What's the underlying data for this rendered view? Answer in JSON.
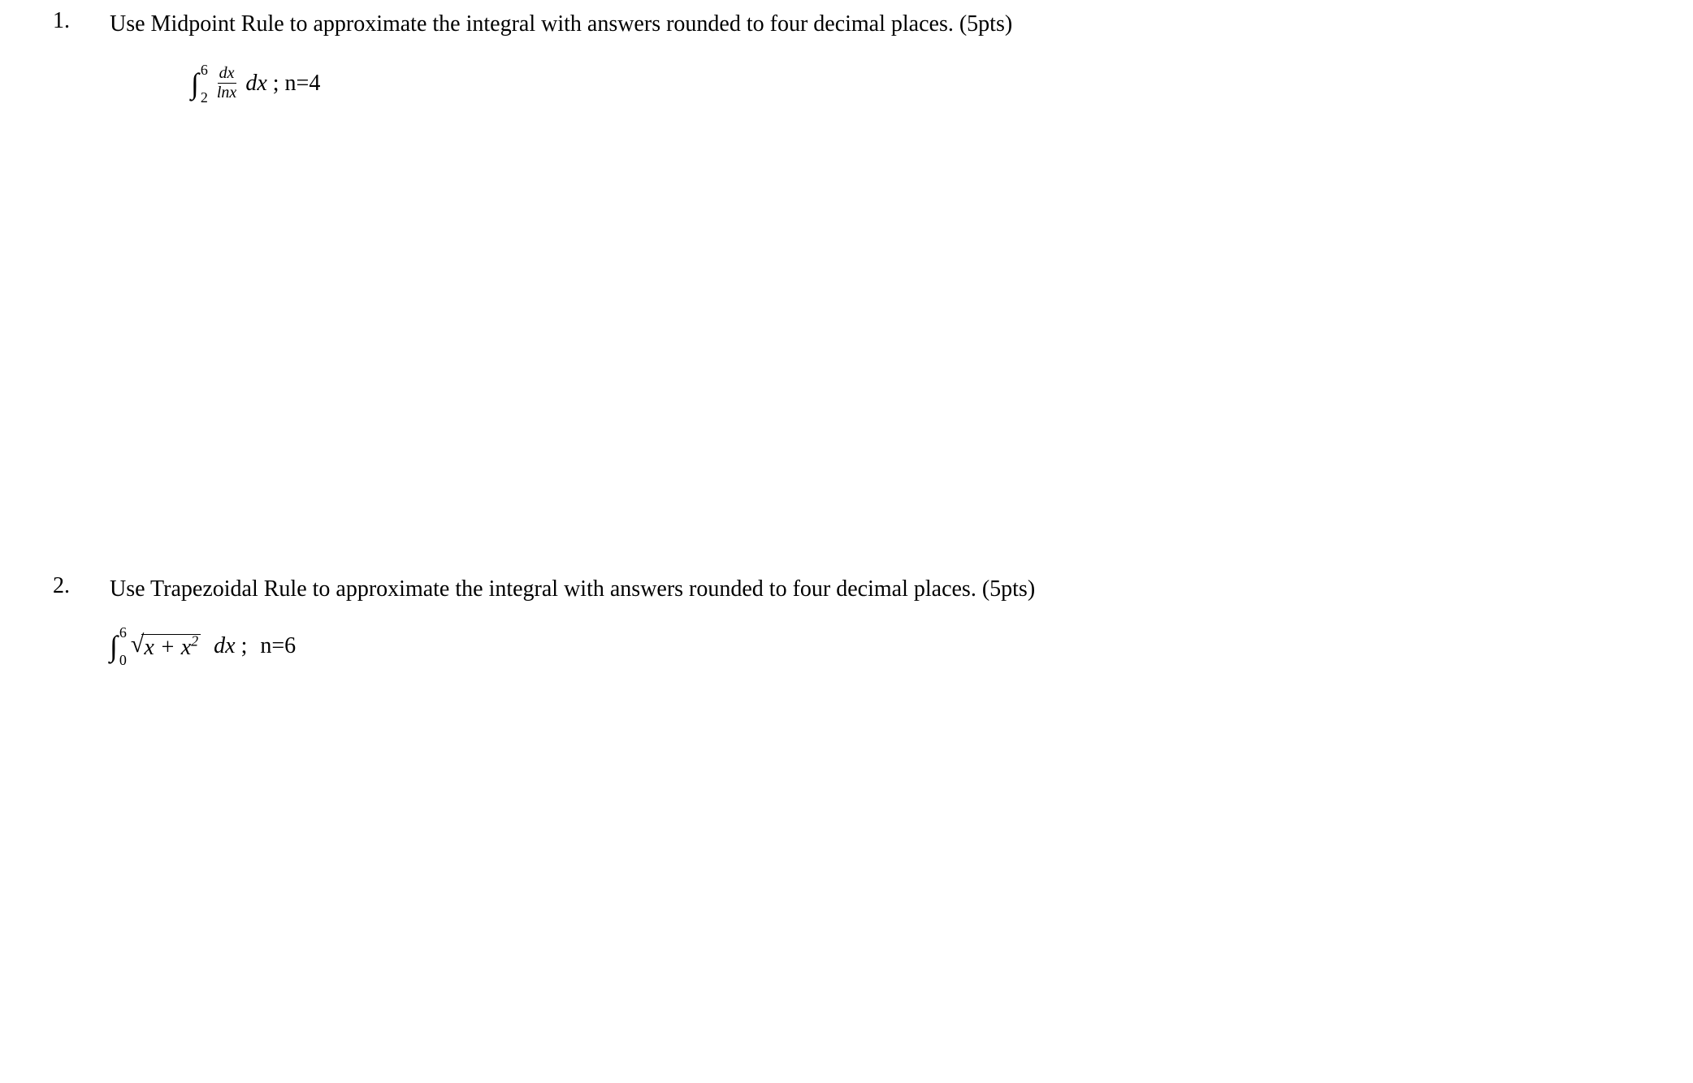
{
  "problems": [
    {
      "number": "1.",
      "text": "Use Midpoint Rule to approximate the integral with answers rounded to four decimal places. (5pts)",
      "integral": {
        "lower_bound": "2",
        "upper_bound": "6",
        "frac_top": "dx",
        "frac_bottom": "lnx",
        "dx": "dx",
        "n_label": "n=4"
      }
    },
    {
      "number": "2.",
      "text": "Use Trapezoidal Rule to approximate the integral with answers rounded to four decimal places. (5pts)",
      "integral": {
        "lower_bound": "0",
        "upper_bound": "6",
        "sqrt_content_x": "x",
        "sqrt_content_plus": " + ",
        "sqrt_content_x2": "x",
        "sqrt_content_exp": "2",
        "dx": "dx",
        "n_label": "n=6"
      }
    }
  ]
}
